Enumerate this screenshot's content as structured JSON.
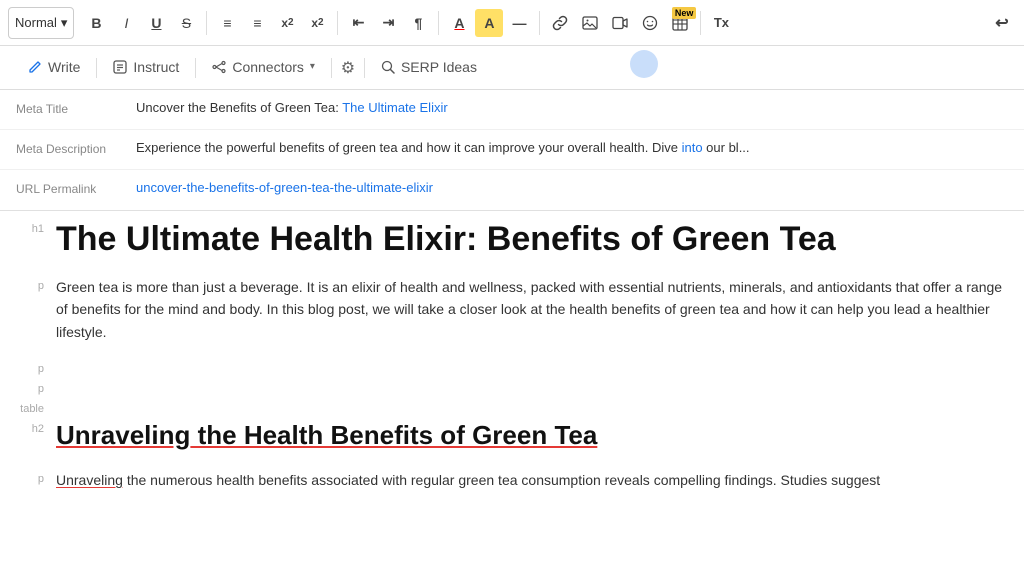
{
  "toolbar": {
    "style_label": "Normal",
    "bold_label": "B",
    "italic_label": "I",
    "underline_label": "U",
    "strikethrough_label": "S",
    "ordered_list_label": "≡",
    "unordered_list_label": "≡",
    "subscript_label": "x₂",
    "superscript_label": "x²",
    "indent_left_label": "⇤",
    "indent_right_label": "⇥",
    "text_direction_label": "¶",
    "font_color_label": "A",
    "highlight_label": "A",
    "hr_label": "—",
    "link_label": "🔗",
    "image_label": "🖼",
    "video_label": "📷",
    "emoji_label": "😊",
    "table_label": "⊞",
    "new_label": "New",
    "clear_label": "Tx",
    "undo_label": "↩"
  },
  "tabs": {
    "write_label": "Write",
    "instruct_label": "Instruct",
    "connectors_label": "Connectors",
    "settings_label": "⚙",
    "serp_label": "SERP Ideas"
  },
  "meta": {
    "title_label": "Meta Title",
    "title_value": "Uncover the Benefits of Green Tea: The Ultimate Elixir",
    "description_label": "Meta Description",
    "description_value": "Experience the powerful benefits of green tea and how it can improve your overall health. Dive into our bl...",
    "url_label": "URL Permalink",
    "url_value": "uncover-the-benefits-of-green-tea-the-ultimate-elixir"
  },
  "content": {
    "h1_tag": "h1",
    "h1_text": "The Ultimate Health Elixir: Benefits of Green Tea",
    "p1_tag": "p",
    "p1_text": "Green tea is more than just a beverage. It is an elixir of health and wellness, packed with essential nutrients, minerals, and antioxidants that offer a range of benefits for the mind and body. In this blog post, we will take a closer look at the health benefits of green tea and how it can help you lead a healthier lifestyle.",
    "p2_tag": "p",
    "p2_text": "",
    "p3_tag": "p",
    "p3_text": "",
    "table_tag": "table",
    "table_text": "",
    "h2_tag": "h2",
    "h2_text": "Unraveling the Health Benefits of Green Tea",
    "p4_tag": "p",
    "p4_text": "Unraveling the numerous health benefits associated with regular green tea consumption reveals compelling findings. Studies suggest"
  }
}
